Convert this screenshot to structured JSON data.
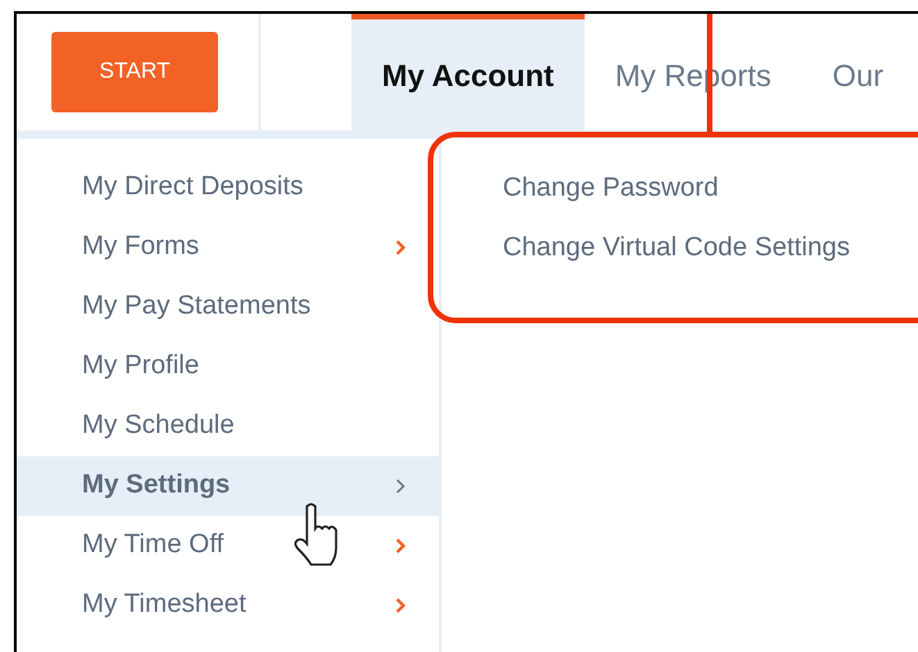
{
  "start_button": {
    "label": "START"
  },
  "tabs": [
    {
      "label": "My Account",
      "selected": true
    },
    {
      "label": "My Reports",
      "selected": false
    },
    {
      "label": "Our",
      "selected": false
    }
  ],
  "sidebar": {
    "items": [
      {
        "label": "My Direct Deposits",
        "selected": false,
        "has_submenu": false
      },
      {
        "label": "My Forms",
        "selected": false,
        "has_submenu": true
      },
      {
        "label": "My Pay Statements",
        "selected": false,
        "has_submenu": false
      },
      {
        "label": "My Profile",
        "selected": false,
        "has_submenu": false
      },
      {
        "label": "My Schedule",
        "selected": false,
        "has_submenu": false
      },
      {
        "label": "My Settings",
        "selected": true,
        "has_submenu": true
      },
      {
        "label": "My Time Off",
        "selected": false,
        "has_submenu": true
      },
      {
        "label": "My Timesheet",
        "selected": false,
        "has_submenu": true
      }
    ]
  },
  "submenu": {
    "items": [
      {
        "label": "Change Password"
      },
      {
        "label": "Change Virtual Code Settings"
      }
    ]
  }
}
